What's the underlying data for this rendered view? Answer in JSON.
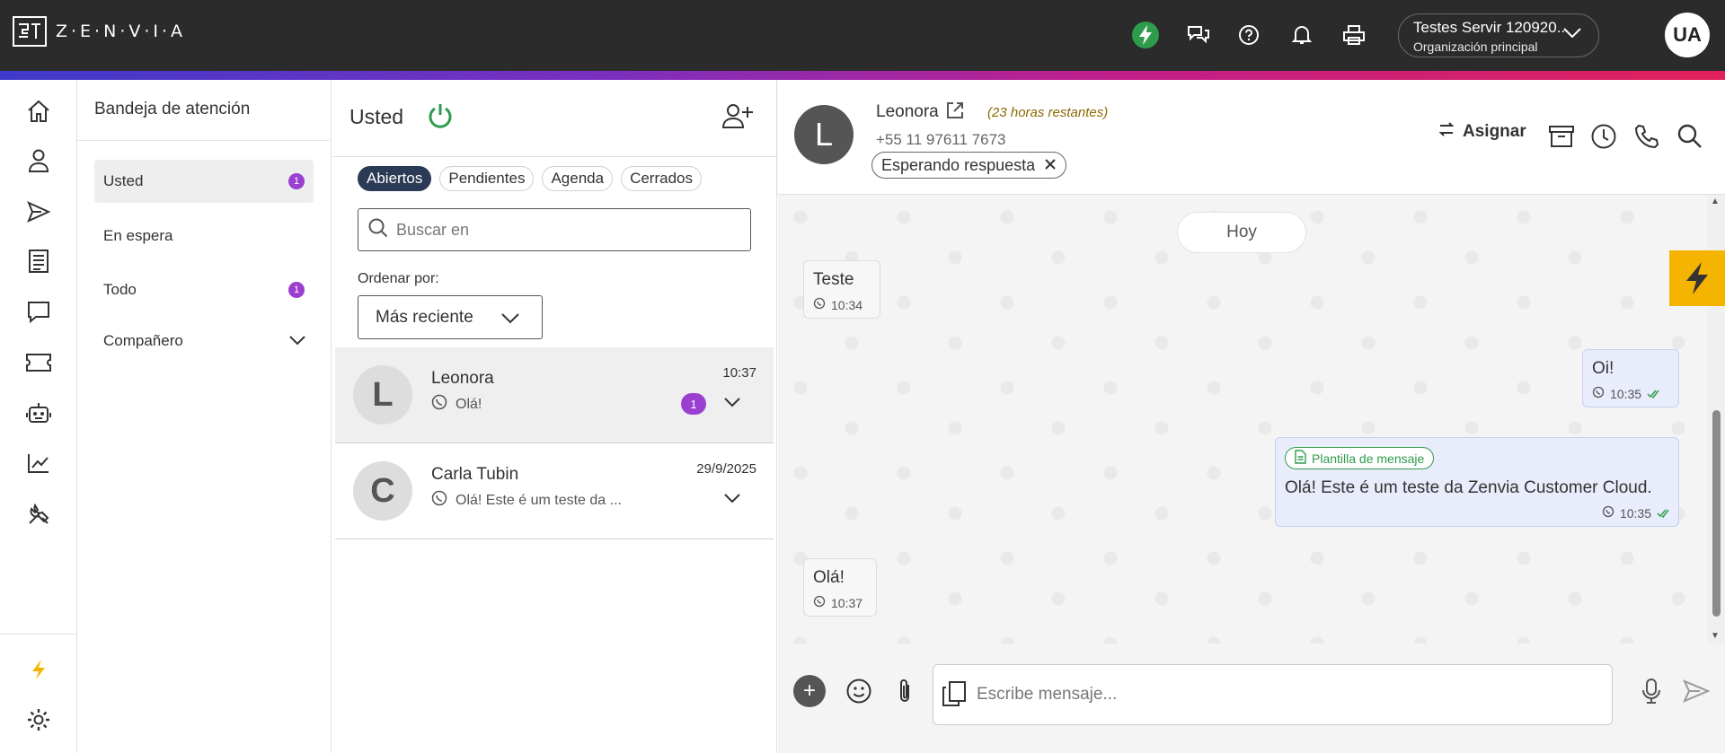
{
  "topbar": {
    "brand": "Z·E·N·V·I·A",
    "org_name": "Testes Servir 120920...",
    "org_sub": "Organización principal",
    "user_initials": "UA",
    "accent_color": "#2e9c4c"
  },
  "rail": {
    "icons": [
      "home-icon",
      "contacts-icon",
      "send-icon",
      "document-icon",
      "chat-icon",
      "ticket-icon",
      "bot-icon",
      "analytics-icon",
      "tools-icon",
      "bolt-icon",
      "settings-icon"
    ]
  },
  "inbox": {
    "title": "Bandeja de atención",
    "items": [
      {
        "label": "Usted",
        "badge": "1"
      },
      {
        "label": "En espera",
        "badge": ""
      },
      {
        "label": "Todo",
        "badge": "1"
      },
      {
        "label": "Compañero",
        "badge": ""
      }
    ]
  },
  "list": {
    "title": "Usted",
    "tabs": [
      "Abiertos",
      "Pendientes",
      "Agenda",
      "Cerrados"
    ],
    "search_placeholder": "Buscar en",
    "order_label": "Ordenar por:",
    "order_value": "Más reciente",
    "conversations": [
      {
        "initial": "L",
        "name": "Leonora",
        "preview": "Olá!",
        "time": "10:37",
        "unread": "1"
      },
      {
        "initial": "C",
        "name": "Carla Tubin",
        "preview": "Olá! Este é um teste da ...",
        "time": "29/9/2025",
        "unread": ""
      }
    ]
  },
  "chat": {
    "contact_initial": "L",
    "contact_name": "Leonora",
    "remaining": "(23 horas restantes)",
    "phone": "+55 11 97611 7673",
    "status": "Esperando respuesta",
    "assign_label": "Asignar",
    "day_label": "Hoy",
    "messages": [
      {
        "direction": "in",
        "text": "Teste",
        "time": "10:34"
      },
      {
        "direction": "out",
        "text": "Oi!",
        "time": "10:35"
      },
      {
        "direction": "out",
        "tag": "Plantilla de mensaje",
        "text": "Olá! Este é um teste da Zenvia Customer Cloud.",
        "time": "10:35"
      },
      {
        "direction": "in",
        "text": "Olá!",
        "time": "10:37"
      }
    ],
    "composer_placeholder": "Escribe mensaje..."
  }
}
